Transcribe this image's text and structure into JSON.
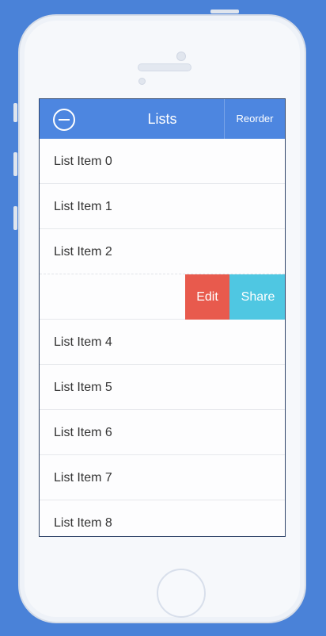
{
  "navbar": {
    "title": "Lists",
    "left_icon": "minus-circle-icon",
    "right_button": "Reorder"
  },
  "list": {
    "items": [
      {
        "label": "List Item 0"
      },
      {
        "label": "List Item 1"
      },
      {
        "label": "List Item 2"
      },
      {
        "label": "",
        "swiped": true
      },
      {
        "label": "List Item 4"
      },
      {
        "label": "List Item 5"
      },
      {
        "label": "List Item 6"
      },
      {
        "label": "List Item 7"
      },
      {
        "label": "List Item 8"
      }
    ],
    "swipe_actions": {
      "edit": "Edit",
      "share": "Share"
    }
  },
  "colors": {
    "accent": "#4d86e0",
    "edit": "#e85a4d",
    "share": "#4fc7e2",
    "background": "#4a82d8"
  }
}
